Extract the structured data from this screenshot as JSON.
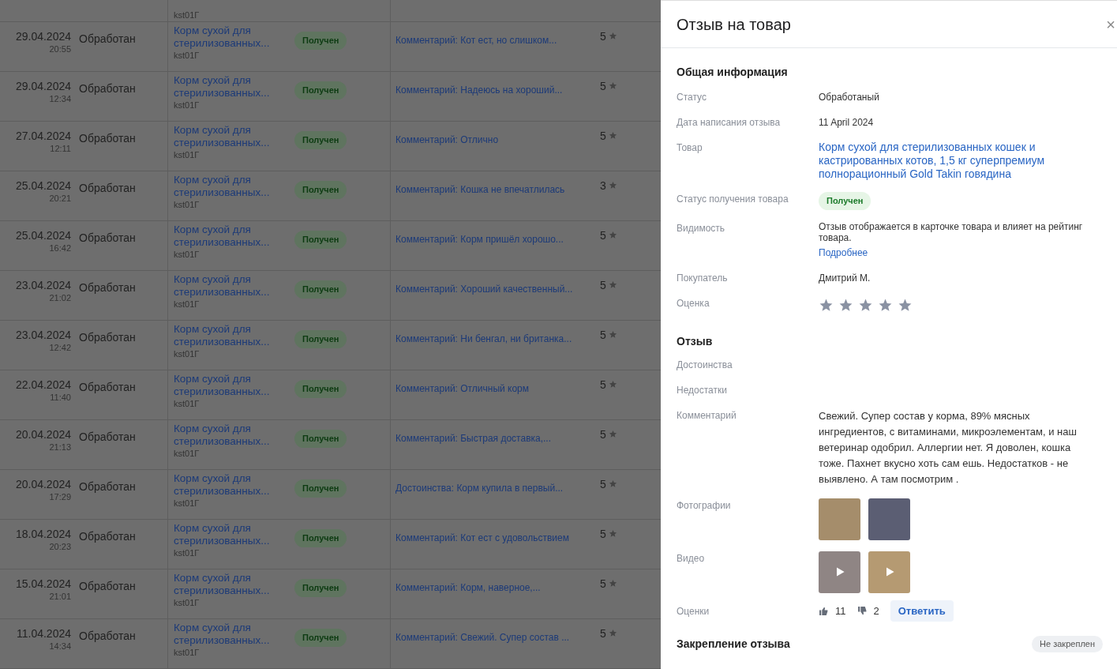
{
  "table": {
    "top_partial_row": {
      "sku": "kst01Г"
    },
    "rows": [
      {
        "date": "29.04.2024",
        "time": "20:55",
        "status": "Обработан",
        "product": "Корм сухой для стерилизованных...",
        "sku": "kst01Г",
        "delivery": "Получен",
        "text": "Комментарий: Кот ест, но слишком...",
        "rating": "5"
      },
      {
        "date": "29.04.2024",
        "time": "12:34",
        "status": "Обработан",
        "product": "Корм сухой для стерилизованных...",
        "sku": "kst01Г",
        "delivery": "Получен",
        "text": "Комментарий: Надеюсь на хороший...",
        "rating": "5"
      },
      {
        "date": "27.04.2024",
        "time": "12:11",
        "status": "Обработан",
        "product": "Корм сухой для стерилизованных...",
        "sku": "kst01Г",
        "delivery": "Получен",
        "text": "Комментарий: Отлично",
        "rating": "5"
      },
      {
        "date": "25.04.2024",
        "time": "20:21",
        "status": "Обработан",
        "product": "Корм сухой для стерилизованных...",
        "sku": "kst01Г",
        "delivery": "Получен",
        "text": "Комментарий: Кошка не впечатлилась",
        "rating": "3"
      },
      {
        "date": "25.04.2024",
        "time": "16:42",
        "status": "Обработан",
        "product": "Корм сухой для стерилизованных...",
        "sku": "kst01Г",
        "delivery": "Получен",
        "text": "Комментарий: Корм пришёл хорошо...",
        "rating": "5"
      },
      {
        "date": "23.04.2024",
        "time": "21:02",
        "status": "Обработан",
        "product": "Корм сухой для стерилизованных...",
        "sku": "kst01Г",
        "delivery": "Получен",
        "text": "Комментарий: Хороший качественный...",
        "rating": "5"
      },
      {
        "date": "23.04.2024",
        "time": "12:42",
        "status": "Обработан",
        "product": "Корм сухой для стерилизованных...",
        "sku": "kst01Г",
        "delivery": "Получен",
        "text": "Комментарий: Ни бенгал, ни британка...",
        "rating": "5"
      },
      {
        "date": "22.04.2024",
        "time": "11:40",
        "status": "Обработан",
        "product": "Корм сухой для стерилизованных...",
        "sku": "kst01Г",
        "delivery": "Получен",
        "text": "Комментарий: Отличный корм",
        "rating": "5"
      },
      {
        "date": "20.04.2024",
        "time": "21:13",
        "status": "Обработан",
        "product": "Корм сухой для стерилизованных...",
        "sku": "kst01Г",
        "delivery": "Получен",
        "text": "Комментарий: Быстрая доставка,...",
        "rating": "5"
      },
      {
        "date": "20.04.2024",
        "time": "17:29",
        "status": "Обработан",
        "product": "Корм сухой для стерилизованных...",
        "sku": "kst01Г",
        "delivery": "Получен",
        "text": "Достоинства: Корм купила в первый...",
        "rating": "5"
      },
      {
        "date": "18.04.2024",
        "time": "20:23",
        "status": "Обработан",
        "product": "Корм сухой для стерилизованных...",
        "sku": "kst01Г",
        "delivery": "Получен",
        "text": "Комментарий: Кот ест с удовольствием",
        "rating": "5"
      },
      {
        "date": "15.04.2024",
        "time": "21:01",
        "status": "Обработан",
        "product": "Корм сухой для стерилизованных...",
        "sku": "kst01Г",
        "delivery": "Получен",
        "text": "Комментарий: Корм, наверное,...",
        "rating": "5"
      },
      {
        "date": "11.04.2024",
        "time": "14:34",
        "status": "Обработан",
        "product": "Корм сухой для стерилизованных...",
        "sku": "kst01Г",
        "delivery": "Получен",
        "text": "Комментарий: Свежий. Супер состав ...",
        "rating": "5"
      }
    ]
  },
  "panel": {
    "title": "Отзыв на товар",
    "close": "×",
    "general": {
      "heading": "Общая информация",
      "fields": [
        {
          "kind": "text",
          "label": "Статус",
          "value": "Обработаный"
        },
        {
          "kind": "text",
          "label": "Дата написания отзыва",
          "value": "11 April 2024"
        },
        {
          "kind": "link",
          "label": "Товар",
          "value": "Корм сухой для стерилизованных кошек и кастрированных котов, 1,5 кг суперпремиум полнорационный Gold Takin говядина"
        },
        {
          "kind": "badge",
          "label": "Статус получения товара",
          "value": "Получен"
        },
        {
          "kind": "note",
          "label": "Видимость",
          "value": "Отзыв отображается в карточке товара и влияет на рейтинг товара.",
          "link": "Подробнее"
        },
        {
          "kind": "text",
          "label": "Покупатель",
          "value": "Дмитрий М."
        },
        {
          "kind": "stars",
          "label": "Оценка",
          "stars": 5
        }
      ]
    },
    "review": {
      "heading": "Отзыв",
      "fields": [
        {
          "kind": "empty",
          "label": "Достоинства"
        },
        {
          "kind": "empty",
          "label": "Недостатки"
        },
        {
          "kind": "comment",
          "label": "Комментарий",
          "value": "Свежий. Супер состав у корма, 89% мясных ингредиентов, с витаминами, микроэлементам, и наш ветеринар одобрил. Аллергии нет. Я доволен, кошка тоже. Пахнет вкусно хоть сам ешь. Недостатков - не выявлено. А там посмотрим ."
        },
        {
          "kind": "photos",
          "label": "Фотографии"
        },
        {
          "kind": "videos",
          "label": "Видео"
        },
        {
          "kind": "votes",
          "label": "Оценки",
          "likes": "11",
          "dislikes": "2",
          "button": "Ответить"
        }
      ]
    },
    "pin": {
      "label": "Закрепление отзыва",
      "badge": "Не закреплен"
    }
  }
}
